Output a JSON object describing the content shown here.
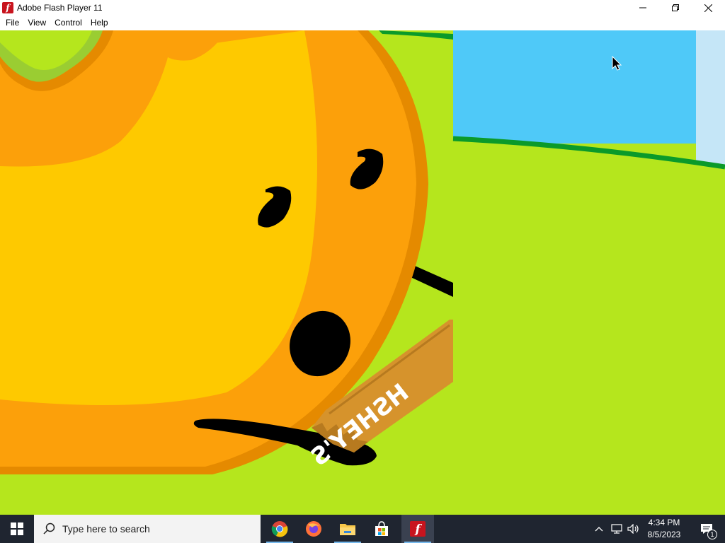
{
  "window": {
    "title": "Adobe Flash Player 11",
    "controls": {
      "minimize": "minimize-icon",
      "restore": "restore-icon",
      "close": "close-icon"
    }
  },
  "menu": [
    "File",
    "View",
    "Control",
    "Help"
  ],
  "stage": {
    "candy_bar_text": "HSHEY'S",
    "colors": {
      "grass": "#b5e61d",
      "sky": "#4fc9f8",
      "character_outer": "#f39c12",
      "character_inner": "#fdc800",
      "wrapper": "#d6932c"
    }
  },
  "taskbar": {
    "search_placeholder": "Type here to search",
    "apps": [
      {
        "name": "chrome",
        "icon": "chrome-icon"
      },
      {
        "name": "firefox",
        "icon": "firefox-icon"
      },
      {
        "name": "file-explorer",
        "icon": "folder-icon"
      },
      {
        "name": "microsoft-store",
        "icon": "store-icon"
      },
      {
        "name": "flash-player",
        "icon": "flash-icon",
        "active": true
      }
    ],
    "tray_icons": [
      "chevron-up-icon",
      "network-icon",
      "volume-icon"
    ],
    "time": "4:34 PM",
    "date": "8/5/2023",
    "notification_count": "1"
  }
}
